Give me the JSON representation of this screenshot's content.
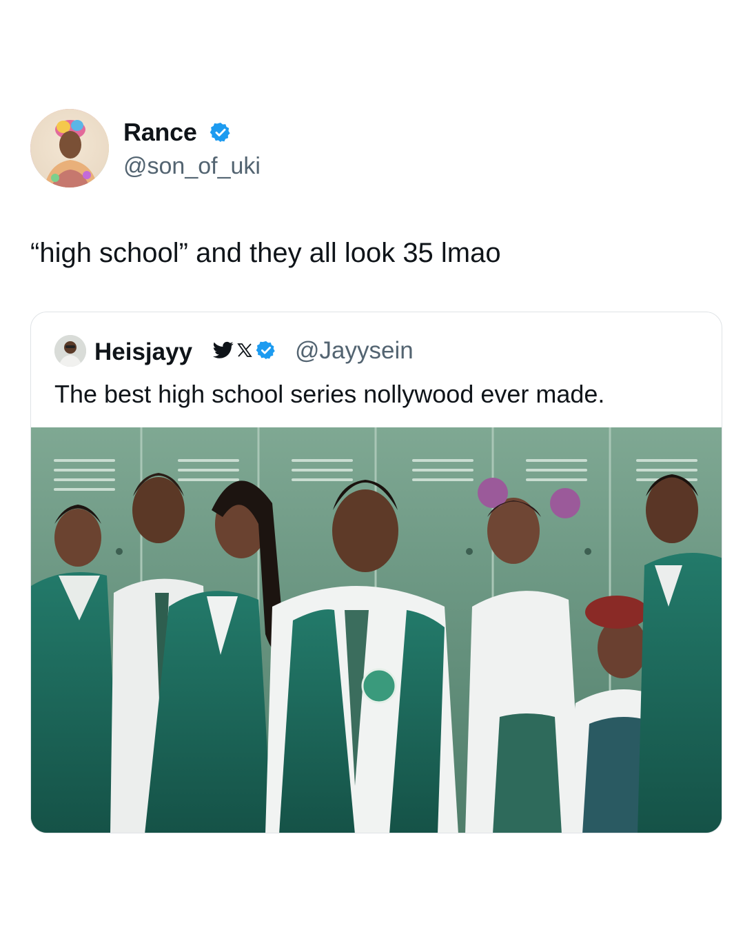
{
  "tweet": {
    "author": {
      "name": "Rance",
      "handle": "@son_of_uki",
      "verified_icon": "verified-badge-icon",
      "avatar_icon": "avatar"
    },
    "text": "“high school” and they all look 35 lmao"
  },
  "quoted_tweet": {
    "author": {
      "name": "Heisjayy",
      "icons": [
        "twitter-bird-icon",
        "x-logo-icon",
        "verified-badge-icon"
      ],
      "handle": "@Jayysein"
    },
    "text": "The best high school series nollywood ever made.",
    "media": "photo of eight students in green school uniforms in front of lockers"
  },
  "colors": {
    "text_primary": "#0f1419",
    "text_secondary": "#536471",
    "verified_blue": "#1d9bf0",
    "border": "#dfe3e6",
    "locker_green": "#6f9a82",
    "uniform_teal": "#1f6b5e"
  }
}
